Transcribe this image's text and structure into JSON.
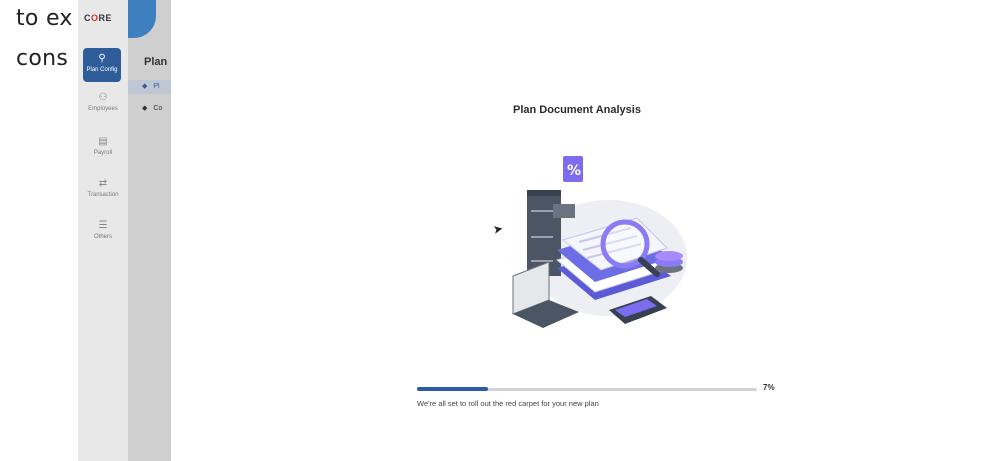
{
  "caption": {
    "line1": "to ex",
    "line2": "cons"
  },
  "brand": {
    "name_pre": "C",
    "name_o": "O",
    "name_post": "RE"
  },
  "rail": {
    "items": [
      {
        "label": "Plan Config",
        "icon": "wrench-icon",
        "glyph": "⚲"
      },
      {
        "label": "Employees",
        "icon": "person-icon",
        "glyph": "⚇"
      },
      {
        "label": "Payroll",
        "icon": "document-icon",
        "glyph": "▤"
      },
      {
        "label": "Transaction",
        "icon": "transfer-icon",
        "glyph": "⇄"
      },
      {
        "label": "Others",
        "icon": "menu-icon",
        "glyph": "☰"
      }
    ]
  },
  "subnav": {
    "title": "Plan",
    "items": [
      {
        "label": "Pl"
      },
      {
        "label": "Co"
      }
    ]
  },
  "main": {
    "heading": "Plan Document Analysis",
    "progress": {
      "value": 0.07,
      "label": "7%"
    },
    "message": "We're all set to roll out the red carpet for your new plan"
  },
  "colors": {
    "accent": "#2f5d9a",
    "illustration": "#7b6cf0",
    "progress": "#2a5aa8"
  }
}
